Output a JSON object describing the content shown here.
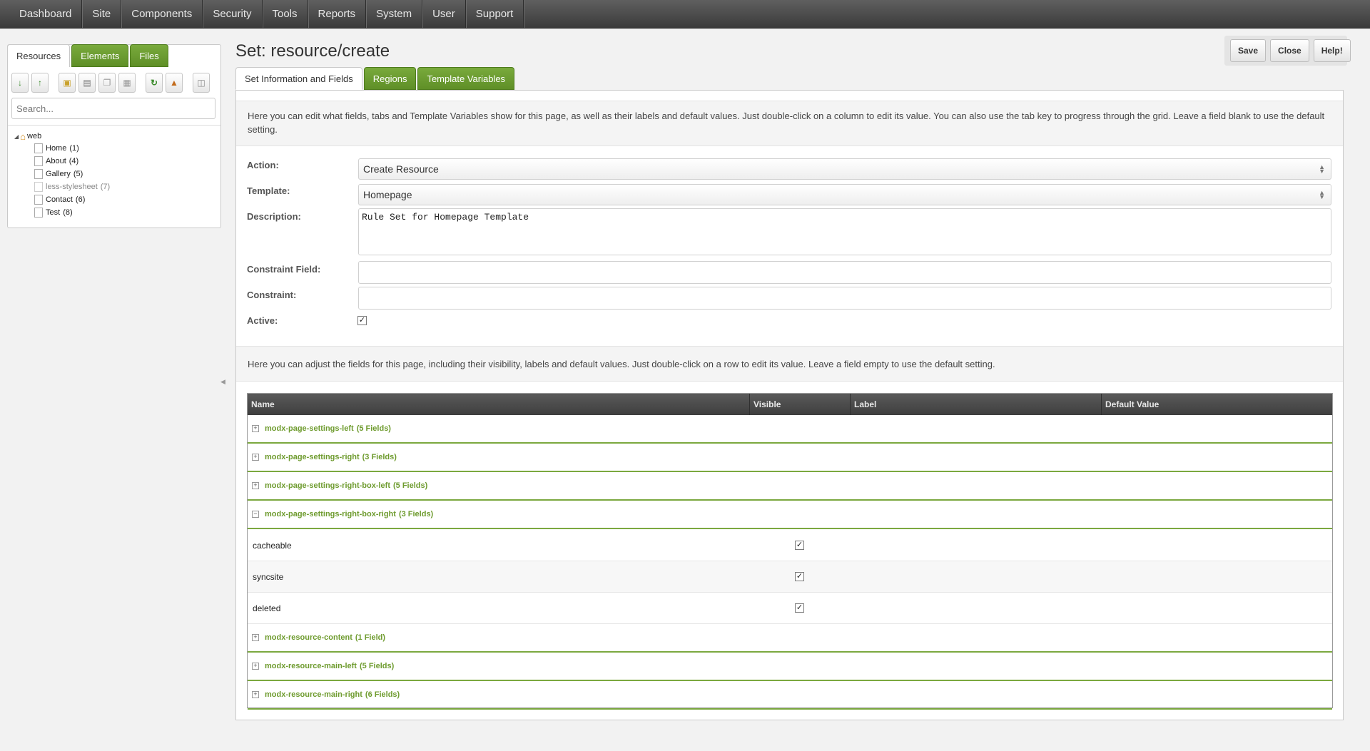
{
  "topnav": {
    "items": [
      "Dashboard",
      "Site",
      "Components",
      "Security",
      "Tools",
      "Reports",
      "System",
      "User",
      "Support"
    ]
  },
  "left": {
    "tabs": [
      "Resources",
      "Elements",
      "Files"
    ],
    "toolbar_icons": [
      "sort-down-icon",
      "sort-up-icon",
      "new-folder-icon",
      "new-weblink-icon",
      "new-symlink-icon",
      "new-static-icon",
      "refresh-icon",
      "publish-icon",
      "trash-icon"
    ],
    "search_placeholder": "Search...",
    "tree": {
      "root": "web",
      "items": [
        {
          "label": "Home",
          "count": "(1)",
          "muted": false
        },
        {
          "label": "About",
          "count": "(4)",
          "muted": false
        },
        {
          "label": "Gallery",
          "count": "(5)",
          "muted": false
        },
        {
          "label": "less-stylesheet",
          "count": "(7)",
          "muted": true
        },
        {
          "label": "Contact",
          "count": "(6)",
          "muted": false
        },
        {
          "label": "Test",
          "count": "(8)",
          "muted": false
        }
      ]
    }
  },
  "page": {
    "title": "Set: resource/create",
    "buttons": {
      "save": "Save",
      "close": "Close",
      "help": "Help!"
    },
    "tabs": [
      "Set Information and Fields",
      "Regions",
      "Template Variables"
    ]
  },
  "form": {
    "intro": "Here you can edit what fields, tabs and Template Variables show for this page, as well as their labels and default values. Just double-click on a column to edit its value. You can also use the tab key to progress through the grid. Leave a field blank to use the default setting.",
    "action_label": "Action:",
    "action_value": "Create Resource",
    "template_label": "Template:",
    "template_value": "Homepage",
    "description_label": "Description:",
    "description_value": "Rule Set for Homepage Template",
    "constraint_field_label": "Constraint Field:",
    "constraint_field_value": "",
    "constraint_label": "Constraint:",
    "constraint_value": "",
    "active_label": "Active:",
    "active_checked": true
  },
  "fields": {
    "intro": "Here you can adjust the fields for this page, including their visibility, labels and default values. Just double-click on a row to edit its value. Leave a field empty to use the default setting.",
    "columns": [
      "Name",
      "Visible",
      "Label",
      "Default Value"
    ],
    "groups": [
      {
        "name": "modx-page-settings-left",
        "count": "(5 Fields)",
        "expanded": false
      },
      {
        "name": "modx-page-settings-right",
        "count": "(3 Fields)",
        "expanded": false
      },
      {
        "name": "modx-page-settings-right-box-left",
        "count": "(5 Fields)",
        "expanded": false
      },
      {
        "name": "modx-page-settings-right-box-right",
        "count": "(3 Fields)",
        "expanded": true
      },
      {
        "name": "modx-resource-content",
        "count": "(1 Field)",
        "expanded": false
      },
      {
        "name": "modx-resource-main-left",
        "count": "(5 Fields)",
        "expanded": false
      },
      {
        "name": "modx-resource-main-right",
        "count": "(6 Fields)",
        "expanded": false
      }
    ],
    "rows": [
      {
        "name": "cacheable",
        "visible": true
      },
      {
        "name": "syncsite",
        "visible": true
      },
      {
        "name": "deleted",
        "visible": true
      }
    ]
  },
  "colors": {
    "accent_green": "#6e9b2e",
    "nav_bg": "#4a4a4a"
  }
}
